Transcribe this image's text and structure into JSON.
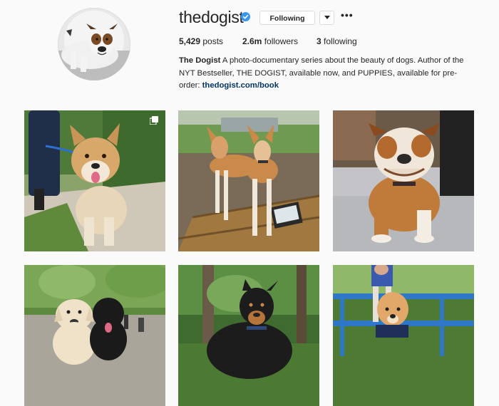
{
  "profile": {
    "username": "thedogist",
    "verified_icon": "verified-badge-icon",
    "follow_button": "Following",
    "more_icon": "more-options-icon",
    "more_text": "•••"
  },
  "stats": {
    "posts_count": "5,429",
    "posts_label": "posts",
    "followers_count": "2.6m",
    "followers_label": "followers",
    "following_count": "3",
    "following_label": "following"
  },
  "bio": {
    "name": "The Dogist",
    "text": " A photo-documentary series about the beauty of dogs. Author of the NYT Bestseller, THE DOGIST, available now, and PUPPIES, available for pre-order: ",
    "link": "thedogist.com/book"
  },
  "posts": [
    {
      "label": "post-shepherd-mix",
      "multiple": true
    },
    {
      "label": "post-two-hounds",
      "multiple": false
    },
    {
      "label": "post-bulldog",
      "multiple": false
    },
    {
      "label": "post-labs",
      "multiple": false
    },
    {
      "label": "post-black-tan-dog",
      "multiple": false
    },
    {
      "label": "post-golden-puppy",
      "multiple": false
    }
  ],
  "colors": {
    "verified_blue": "#3897f0",
    "link": "#003569",
    "border": "#dbdbdb"
  }
}
